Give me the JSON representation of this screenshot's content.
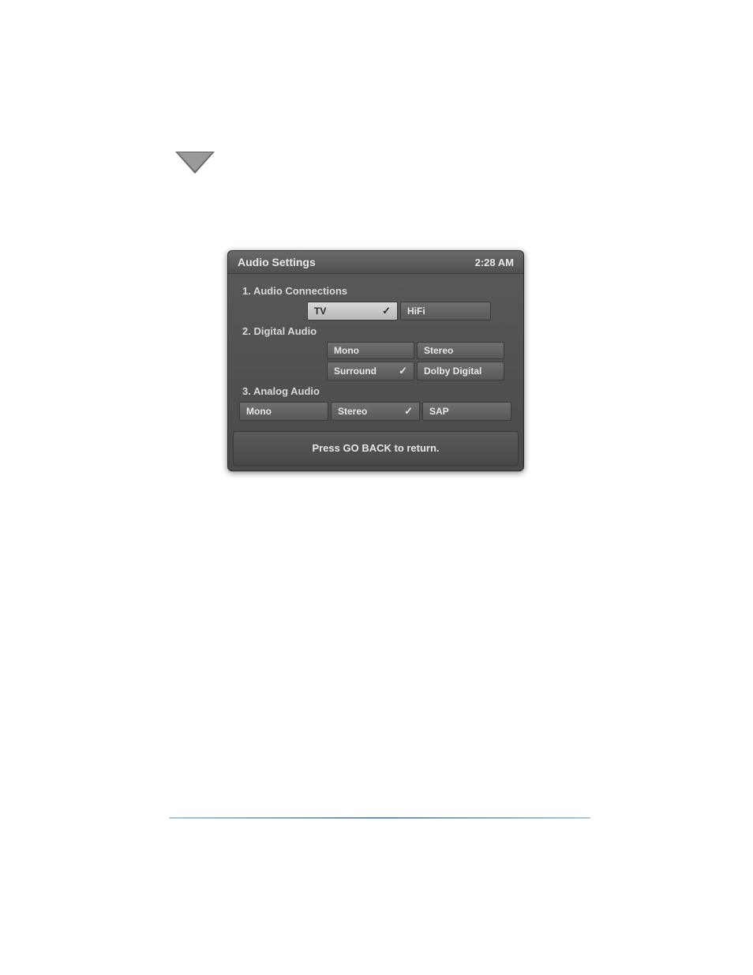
{
  "triangle_icon": "down-triangle",
  "dialog": {
    "title": "Audio Settings",
    "time": "2:28 AM",
    "sections": {
      "audio_connections": {
        "label": "1.  Audio Connections",
        "options": {
          "tv": "TV",
          "hifi": "HiFi"
        },
        "selected": "tv"
      },
      "digital_audio": {
        "label": "2.  Digital Audio",
        "options": {
          "mono": "Mono",
          "stereo": "Stereo",
          "surround": "Surround",
          "dolby": "Dolby Digital"
        },
        "selected": "surround"
      },
      "analog_audio": {
        "label": "3.  Analog Audio",
        "options": {
          "mono": "Mono",
          "stereo": "Stereo",
          "sap": "SAP"
        },
        "selected": "stereo"
      }
    },
    "footer": "Press GO BACK to return."
  }
}
